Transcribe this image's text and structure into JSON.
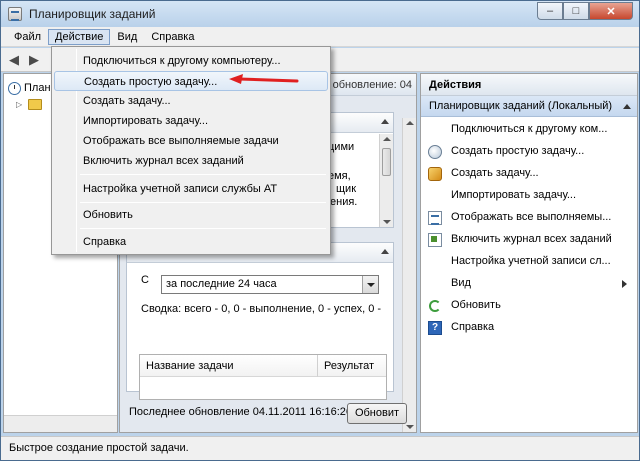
{
  "window": {
    "title": "Планировщик заданий"
  },
  "menubar": {
    "items": [
      "Файл",
      "Действие",
      "Вид",
      "Справка"
    ]
  },
  "tree": {
    "root_label": "Плани"
  },
  "center": {
    "header_fragment": "ледне обновление: 04",
    "fragments": [
      "цими",
      "емя,",
      "щик",
      "ения."
    ],
    "range_label": "С",
    "range_value": "за последние 24 часа",
    "summary": "Сводка: всего - 0, 0 - выполнение, 0 - успех, 0 - ",
    "table_columns": [
      "Название задачи",
      "Результат"
    ],
    "last_update": "Последнее обновление 04.11.2011 16:16:26",
    "refresh_label": "Обновит"
  },
  "actions": {
    "title": "Действия",
    "subtitle": "Планировщик заданий (Локальный)",
    "items": [
      {
        "label": "Подключиться к другому ком...",
        "icon": "none"
      },
      {
        "label": "Создать простую задачу...",
        "icon": "wizard-icon"
      },
      {
        "label": "Создать задачу...",
        "icon": "create-task-icon"
      },
      {
        "label": "Импортировать задачу...",
        "icon": "none"
      },
      {
        "label": "Отображать все выполняемы...",
        "icon": "running-tasks-icon"
      },
      {
        "label": "Включить журнал всех заданий",
        "icon": "log-icon"
      },
      {
        "label": "Настройка учетной записи сл...",
        "icon": "none"
      },
      {
        "label": "Вид",
        "icon": "none"
      },
      {
        "label": "Обновить",
        "icon": "refresh-icon"
      },
      {
        "label": "Справка",
        "icon": "help-icon"
      }
    ]
  },
  "dropdown": {
    "items": [
      "Подключиться к другому компьютеру...",
      "Создать простую задачу...",
      "Создать задачу...",
      "Импортировать задачу...",
      "Отображать все выполняемые задачи",
      "Включить журнал всех заданий",
      "Настройка учетной записи службы AT",
      "Обновить",
      "Справка"
    ],
    "highlighted_item": "Создать простую задачу..."
  },
  "annotation": {
    "arrow_color": "#e02020"
  },
  "statusbar": {
    "text": "Быстрое создание простой задачи."
  }
}
